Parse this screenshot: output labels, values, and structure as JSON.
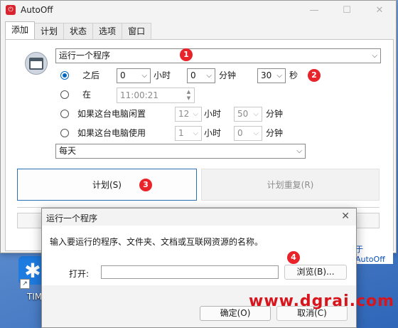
{
  "desktop": {
    "icon_glyph": "✱",
    "icon_label": "TIM",
    "shortcut_glyph": "↗"
  },
  "window": {
    "title": "AutoOff",
    "app_icon_glyph": "⏻",
    "controls": {
      "minimize": "—",
      "maximize": "☐",
      "close": "✕"
    }
  },
  "tabs": [
    {
      "label": "添加"
    },
    {
      "label": "计划"
    },
    {
      "label": "状态"
    },
    {
      "label": "选项"
    },
    {
      "label": "窗口"
    }
  ],
  "action": {
    "selected": "运行一个程序",
    "badge": "1"
  },
  "after": {
    "label": "之后",
    "hours": "0",
    "hours_unit": "小时",
    "minutes": "0",
    "minutes_unit": "分钟",
    "seconds": "30",
    "seconds_unit": "秒",
    "badge": "2"
  },
  "at": {
    "label": "在",
    "time": "11:00:21"
  },
  "idle": {
    "label": "如果这台电脑闲置",
    "hours": "12",
    "hours_unit": "小时",
    "minutes": "50",
    "minutes_unit": "分钟"
  },
  "in_use": {
    "label": "如果这台电脑使用",
    "hours": "1",
    "hours_unit": "小时",
    "minutes": "0",
    "minutes_unit": "分钟"
  },
  "recurrence": {
    "selected": "每天"
  },
  "buttons": {
    "plan": "计划(S)",
    "plan_badge": "3",
    "repeat": "计划重复(R)"
  },
  "about": {
    "prefix": "于",
    "name": "AutoOff"
  },
  "run_dialog": {
    "title": "运行一个程序",
    "description": "输入要运行的程序、文件夹、文档或互联网资源的名称。",
    "open_label": "打开:",
    "open_value": "",
    "browse": "浏览(B)...",
    "browse_badge": "4",
    "ok": "确定(O)",
    "cancel": "取消(C)"
  },
  "watermark": "www.dgrai.com",
  "colors": {
    "accent": "#0067c0",
    "badge": "#e8232a",
    "watermark": "#d8141c"
  }
}
